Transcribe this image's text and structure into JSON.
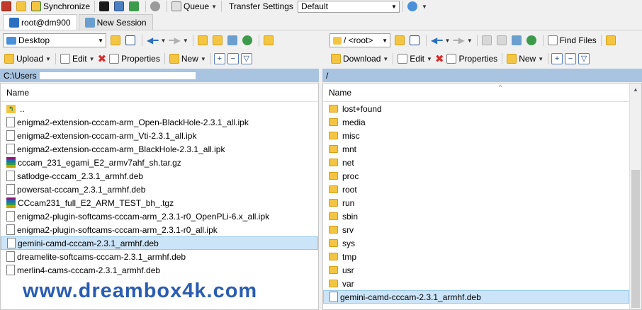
{
  "toolbar": {
    "synchronize": "Synchronize",
    "queue": "Queue",
    "transfer_settings_label": "Transfer Settings",
    "transfer_settings_value": "Default"
  },
  "tabs": [
    {
      "label": "root@dm900"
    },
    {
      "label": "New Session"
    }
  ],
  "left": {
    "location": "Desktop",
    "upload": "Upload",
    "edit": "Edit",
    "properties": "Properties",
    "new": "New",
    "path": "C:\\Users",
    "column_name": "Name",
    "files": [
      {
        "name": "..",
        "type": "up"
      },
      {
        "name": "enigma2-extension-cccam-arm_Open-BlackHole-2.3.1_all.ipk",
        "type": "file"
      },
      {
        "name": "enigma2-extension-cccam-arm_Vti-2.3.1_all.ipk",
        "type": "file"
      },
      {
        "name": "enigma2-extension-cccam-arm_BlackHole-2.3.1_all.ipk",
        "type": "file"
      },
      {
        "name": "cccam_231_egami_E2_armv7ahf_sh.tar.gz",
        "type": "archive"
      },
      {
        "name": "satlodge-cccam_2.3.1_armhf.deb",
        "type": "file"
      },
      {
        "name": "powersat-cccam_2.3.1_armhf.deb",
        "type": "file"
      },
      {
        "name": "CCcam231_full_E2_ARM_TEST_bh_.tgz",
        "type": "archive"
      },
      {
        "name": "enigma2-plugin-softcams-cccam-arm_2.3.1-r0_OpenPLi-6.x_all.ipk",
        "type": "file"
      },
      {
        "name": "enigma2-plugin-softcams-cccam-arm_2.3.1-r0_all.ipk",
        "type": "file"
      },
      {
        "name": "gemini-camd-cccam-2.3.1_armhf.deb",
        "type": "file",
        "selected": true
      },
      {
        "name": "dreamelite-softcams-cccam-2.3.1_armhf.deb",
        "type": "file"
      },
      {
        "name": "merlin4-cams-cccam-2.3.1_armhf.deb",
        "type": "file"
      }
    ]
  },
  "right": {
    "location": "/ <root>",
    "find_files": "Find Files",
    "download": "Download",
    "edit": "Edit",
    "properties": "Properties",
    "new": "New",
    "path": "/",
    "column_name": "Name",
    "files": [
      {
        "name": "lost+found",
        "type": "folder"
      },
      {
        "name": "media",
        "type": "folder"
      },
      {
        "name": "misc",
        "type": "folder"
      },
      {
        "name": "mnt",
        "type": "folder"
      },
      {
        "name": "net",
        "type": "folder"
      },
      {
        "name": "proc",
        "type": "folder"
      },
      {
        "name": "root",
        "type": "folder"
      },
      {
        "name": "run",
        "type": "folder"
      },
      {
        "name": "sbin",
        "type": "folder"
      },
      {
        "name": "srv",
        "type": "folder"
      },
      {
        "name": "sys",
        "type": "folder"
      },
      {
        "name": "tmp",
        "type": "folder"
      },
      {
        "name": "usr",
        "type": "folder"
      },
      {
        "name": "var",
        "type": "folder"
      },
      {
        "name": "gemini-camd-cccam-2.3.1_armhf.deb",
        "type": "file",
        "selected": true
      }
    ]
  },
  "watermark": "www.dreambox4k.com",
  "colors": {
    "pathbar": "#a8c4e0",
    "selection": "#cce4f7",
    "folder": "#f4c542",
    "watermark": "#2a5db0"
  }
}
